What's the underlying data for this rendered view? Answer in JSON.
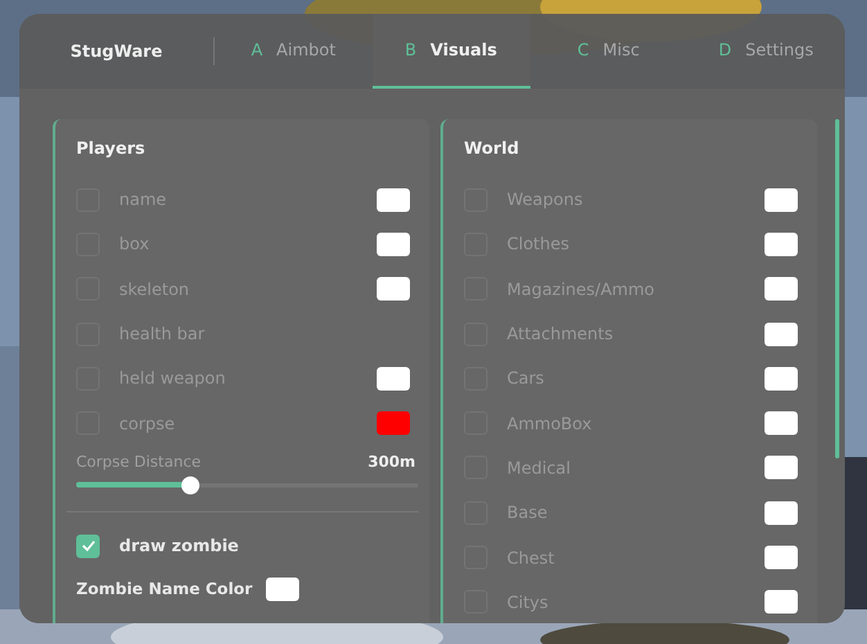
{
  "brand": "StugWare",
  "tabs": [
    {
      "key": "A",
      "label": "Aimbot",
      "selected": false
    },
    {
      "key": "B",
      "label": "Visuals",
      "selected": true
    },
    {
      "key": "C",
      "label": "Misc",
      "selected": false
    },
    {
      "key": "D",
      "label": "Settings",
      "selected": false
    }
  ],
  "players": {
    "title": "Players",
    "items": [
      {
        "label": "name",
        "checked": false,
        "color": "#ffffff"
      },
      {
        "label": "box",
        "checked": false,
        "color": "#ffffff"
      },
      {
        "label": "skeleton",
        "checked": false,
        "color": "#ffffff"
      },
      {
        "label": "health bar",
        "checked": false
      },
      {
        "label": "held weapon",
        "checked": false,
        "color": "#ffffff"
      },
      {
        "label": "corpse",
        "checked": false,
        "color": "#ff0000"
      }
    ],
    "slider": {
      "label": "Corpse Distance",
      "value": "300m",
      "level": 0.33
    },
    "zombie": {
      "label": "draw zombie",
      "checked": true
    },
    "zombie_color": {
      "label": "Zombie Name Color",
      "color": "#ffffff"
    }
  },
  "world": {
    "title": "World",
    "items": [
      {
        "label": "Weapons",
        "checked": false,
        "color": "#ffffff"
      },
      {
        "label": "Clothes",
        "checked": false,
        "color": "#ffffff"
      },
      {
        "label": "Magazines/Ammo",
        "checked": false,
        "color": "#ffffff"
      },
      {
        "label": "Attachments",
        "checked": false,
        "color": "#ffffff"
      },
      {
        "label": "Cars",
        "checked": false,
        "color": "#ffffff"
      },
      {
        "label": "AmmoBox",
        "checked": false,
        "color": "#ffffff"
      },
      {
        "label": "Medical",
        "checked": false,
        "color": "#ffffff"
      },
      {
        "label": "Base",
        "checked": false,
        "color": "#ffffff"
      },
      {
        "label": "Chest",
        "checked": false,
        "color": "#ffffff"
      },
      {
        "label": "Citys",
        "checked": false,
        "color": "#ffffff"
      }
    ]
  }
}
